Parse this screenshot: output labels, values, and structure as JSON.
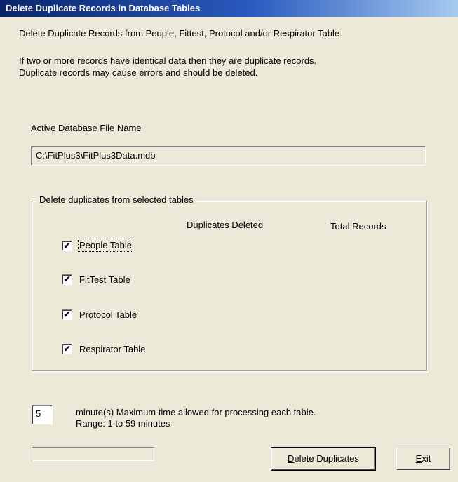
{
  "window": {
    "title": "Delete Duplicate Records in Database Tables"
  },
  "intro": {
    "line1": "Delete Duplicate Records from People, Fittest, Protocol and/or Respirator Table.",
    "line2": "If two or more records have identical data then they are duplicate records.",
    "line3": "Duplicate records may cause errors and should  be deleted."
  },
  "database": {
    "label": "Active Database File Name",
    "value": "C:\\FitPlus3\\FitPlus3Data.mdb"
  },
  "tables_group": {
    "legend": "Delete duplicates from selected tables",
    "col_duplicates": "Duplicates Deleted",
    "col_total": "Total Records",
    "items": [
      {
        "label": "People Table",
        "checked": true
      },
      {
        "label": "FitTest Table",
        "checked": true
      },
      {
        "label": "Protocol Table",
        "checked": true
      },
      {
        "label": "Respirator Table",
        "checked": true
      }
    ]
  },
  "timeout": {
    "value": "5",
    "line1": "minute(s) Maximum time allowed for processing each table.",
    "line2": "Range: 1 to 59 minutes"
  },
  "progress": {
    "fraction": 0
  },
  "buttons": {
    "delete_prefix": "D",
    "delete_rest": "elete Duplicates",
    "exit_prefix": "E",
    "exit_rest": "xit"
  }
}
